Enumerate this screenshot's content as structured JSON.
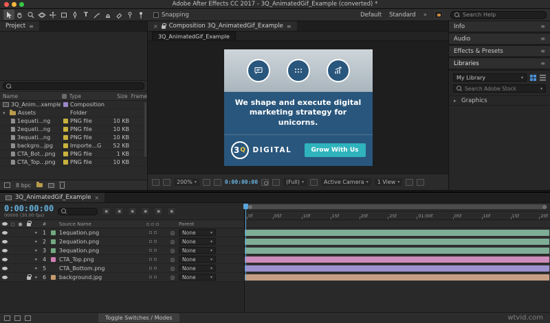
{
  "window": {
    "title": "Adobe After Effects CC 2017 - 3Q_AnimatedGif_Example (converted) *"
  },
  "toolbar": {
    "snapping": "Snapping",
    "workspaces": [
      "Default",
      "Standard"
    ],
    "overflow": "»",
    "search_placeholder": "Search Help"
  },
  "project": {
    "tab": "Project",
    "columns": [
      "Name",
      "Type",
      "Size",
      "Frame"
    ],
    "bit_depth": "8 bpc",
    "items": [
      {
        "name": "3Q_Anim...xample",
        "type": "Composition",
        "size": "",
        "label_color": "#9a86c8"
      },
      {
        "name": "Assets",
        "type": "Folder",
        "size": ""
      },
      {
        "name": "1equati...ng",
        "type": "PNG file",
        "size": "10 KB",
        "label_color": "#c8b23c"
      },
      {
        "name": "2equati...ng",
        "type": "PNG file",
        "size": "10 KB",
        "label_color": "#c8b23c"
      },
      {
        "name": "3equati...ng",
        "type": "PNG file",
        "size": "10 KB",
        "label_color": "#c8b23c"
      },
      {
        "name": "backgro...jpg",
        "type": "Importe...G",
        "size": "52 KB",
        "label_color": "#c8b23c"
      },
      {
        "name": "CTA_Bot...png",
        "type": "PNG file",
        "size": "1 KB",
        "label_color": "#c8b23c"
      },
      {
        "name": "CTA_Top...png",
        "type": "PNG file",
        "size": "10 KB",
        "label_color": "#c8b23c"
      }
    ]
  },
  "composition": {
    "tab": "Composition 3Q_AnimatedGif_Example",
    "view_tab": "3Q_AnimatedGif_Example",
    "zoom": "200%",
    "timecode": "0:00:00:00",
    "resolution": "(Full)",
    "camera": "Active Camera",
    "views": "1 View",
    "ad": {
      "headline": "We shape and execute digital marketing strategy for unicorns.",
      "logo_number": "3",
      "logo_letter": "Q",
      "brand": "DIGITAL",
      "button": "Grow With Us",
      "colors": {
        "navy": "#29567C",
        "teal": "#2FB3BC",
        "light": "#C2CBD2"
      }
    }
  },
  "right_panel": {
    "headers": [
      "Info",
      "Audio",
      "Effects & Presets",
      "Libraries"
    ],
    "library": "My Library",
    "stock_search_placeholder": "Search Adobe Stock",
    "graphics": "Graphics"
  },
  "timeline": {
    "tab": "3Q_AnimatedGif_Example",
    "timecode": "0:00:00:00",
    "frame_info": "00000 (30.00 fps)",
    "source_header": "Source Name",
    "number_header": "#",
    "parent_header": "Parent",
    "parent_value": "None",
    "ruler": [
      "0f",
      "05f",
      "10f",
      "15f",
      "20f",
      "25f",
      "01:00f",
      "05f",
      "10f",
      "15f",
      "20f"
    ],
    "layers": [
      {
        "num": "1",
        "name": "1equation.png",
        "chip": "#73a981",
        "bar": "#7fae97"
      },
      {
        "num": "2",
        "name": "2equation.png",
        "chip": "#73a981",
        "bar": "#7fae97"
      },
      {
        "num": "3",
        "name": "3equation.png",
        "chip": "#73a981",
        "bar": "#7fae97"
      },
      {
        "num": "4",
        "name": "CTA_Top.png",
        "chip": "#cf7fb4",
        "bar": "#cd8cba"
      },
      {
        "num": "5",
        "name": "CTA_Bottom.png",
        "chip": "#9183cb",
        "bar": "#9d92cd"
      },
      {
        "num": "6",
        "name": "background.jpg",
        "chip": "#c59a6e",
        "bar": "#c7a083"
      }
    ],
    "toggle_button": "Toggle Switches / Modes"
  },
  "watermark": "wtvid.com"
}
